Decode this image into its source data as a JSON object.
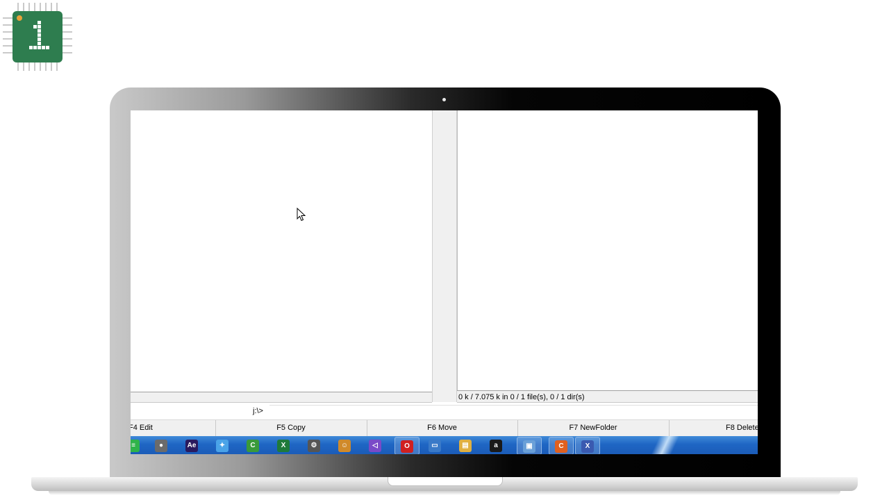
{
  "logo": {
    "text": "1",
    "bg_color": "#2e7d4f",
    "dot_color": "#e8a23a"
  },
  "file_manager": {
    "right_status": "0 k / 7.075 k in 0 / 1 file(s), 0 / 1 dir(s)",
    "command_prompt": "j:\\>",
    "command_value": "",
    "function_keys": [
      {
        "label": "F4 Edit"
      },
      {
        "label": "F5 Copy"
      },
      {
        "label": "F6 Move"
      },
      {
        "label": "F7 NewFolder"
      },
      {
        "label": "F8 Delete"
      }
    ]
  },
  "taskbar": {
    "icons": [
      {
        "name": "green-app-icon",
        "glyph": "≡",
        "color": "#2fb34a"
      },
      {
        "name": "media-icon",
        "glyph": "●",
        "color": "#6b6b6b"
      },
      {
        "name": "after-effects-icon",
        "glyph": "Ae",
        "color": "#2a1a5e"
      },
      {
        "name": "network-icon",
        "glyph": "✦",
        "color": "#4aa3e8"
      },
      {
        "name": "camtasia-icon",
        "glyph": "C",
        "color": "#3a9a3a"
      },
      {
        "name": "excel-icon",
        "glyph": "X",
        "color": "#1f7a3a"
      },
      {
        "name": "settings-icon",
        "glyph": "⚙",
        "color": "#555555"
      },
      {
        "name": "character-icon",
        "glyph": "☺",
        "color": "#d08a2a"
      },
      {
        "name": "visual-studio-icon",
        "glyph": "◁",
        "color": "#7a4ac8"
      },
      {
        "name": "opera-icon",
        "glyph": "O",
        "color": "#d02020"
      },
      {
        "name": "window-icon",
        "glyph": "▭",
        "color": "#3a7ac8"
      },
      {
        "name": "document-icon",
        "glyph": "▤",
        "color": "#e0b040"
      },
      {
        "name": "amazon-icon",
        "glyph": "a",
        "color": "#1a1a1a"
      },
      {
        "name": "monitor-icon",
        "glyph": "▣",
        "color": "#6aa0d8"
      },
      {
        "name": "orange-app-icon",
        "glyph": "C",
        "color": "#e06020"
      },
      {
        "name": "close-app-icon",
        "glyph": "X",
        "color": "#3a5ab0"
      }
    ]
  }
}
